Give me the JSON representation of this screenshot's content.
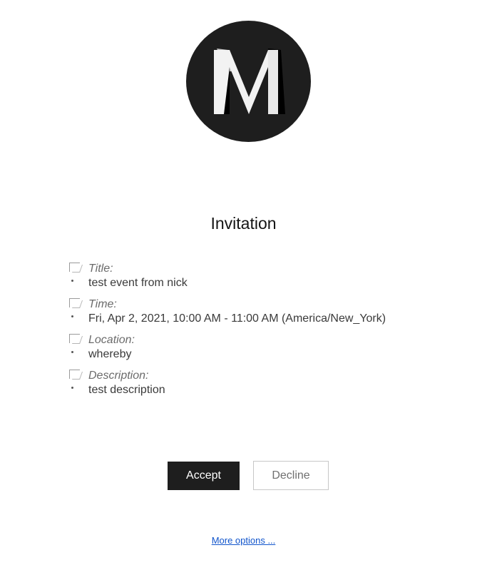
{
  "logo": {
    "icon": "m-logo",
    "letter": "M",
    "colors": {
      "background": "#1e1e1e",
      "front": "#ffffff",
      "shadow": "#000000"
    }
  },
  "heading": "Invitation",
  "details": [
    {
      "label": "Title:",
      "value": "test event from nick"
    },
    {
      "label": "Time:",
      "value": "Fri, Apr 2, 2021, 10:00 AM - 11:00 AM (America/New_York)"
    },
    {
      "label": "Location:",
      "value": "whereby"
    },
    {
      "label": "Description:",
      "value": "test description"
    }
  ],
  "actions": {
    "accept": "Accept",
    "decline": "Decline"
  },
  "more_options": "More options ..."
}
